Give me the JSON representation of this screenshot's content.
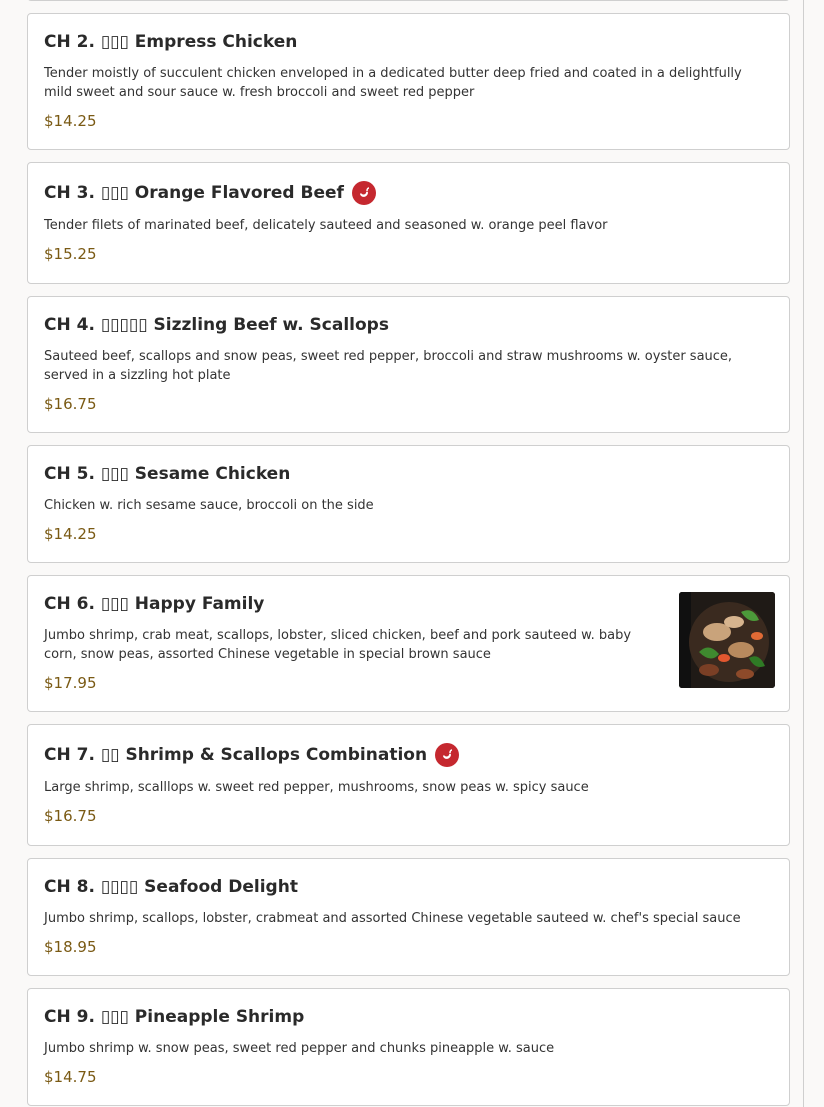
{
  "colors": {
    "spicy_badge": "#c5282f",
    "price": "#7a5a14",
    "border": "#cfcfcf"
  },
  "items": [
    {
      "title": "CH 2. ▯▯▯ Empress Chicken",
      "description": "Tender moistly of succulent chicken enveloped in a dedicated butter deep fried and coated in a delightfully mild sweet and sour sauce w. fresh broccoli and sweet red pepper",
      "price": "$14.25",
      "spicy": false
    },
    {
      "title": "CH 3. ▯▯▯ Orange Flavored Beef",
      "description": "Tender filets of marinated beef, delicately sauteed and seasoned w. orange peel flavor",
      "price": "$15.25",
      "spicy": true,
      "spicy_icon": "chili-pepper-icon"
    },
    {
      "title": "CH 4. ▯▯▯▯▯ Sizzling Beef w. Scallops",
      "description": "Sauteed beef, scallops and snow peas, sweet red pepper, broccoli and straw mushrooms w. oyster sauce, served in a sizzling hot plate",
      "price": "$16.75",
      "spicy": false
    },
    {
      "title": "CH 5. ▯▯▯ Sesame Chicken",
      "description": "Chicken w. rich sesame sauce, broccoli on the side",
      "price": "$14.25",
      "spicy": false
    },
    {
      "title": "CH 6. ▯▯▯ Happy Family",
      "description": "Jumbo shrimp, crab meat, scallops, lobster, sliced chicken, beef and pork sauteed w. baby corn, snow peas, assorted Chinese vegetable in special brown sauce",
      "price": "$17.95",
      "spicy": false,
      "has_photo": true
    },
    {
      "title": "CH 7. ▯▯ Shrimp & Scallops Combination",
      "description": "Large shrimp, scalllops w. sweet red pepper, mushrooms, snow peas w. spicy sauce",
      "price": "$16.75",
      "spicy": true,
      "spicy_icon": "chili-pepper-icon"
    },
    {
      "title": "CH 8. ▯▯▯▯ Seafood Delight",
      "description": "Jumbo shrimp, scallops, lobster, crabmeat and assorted Chinese vegetable sauteed w. chef's special sauce",
      "price": "$18.95",
      "spicy": false
    },
    {
      "title": "CH 9. ▯▯▯ Pineapple Shrimp",
      "description": "Jumbo shrimp w. snow peas, sweet red pepper and chunks pineapple w. sauce",
      "price": "$14.75",
      "spicy": false
    }
  ]
}
